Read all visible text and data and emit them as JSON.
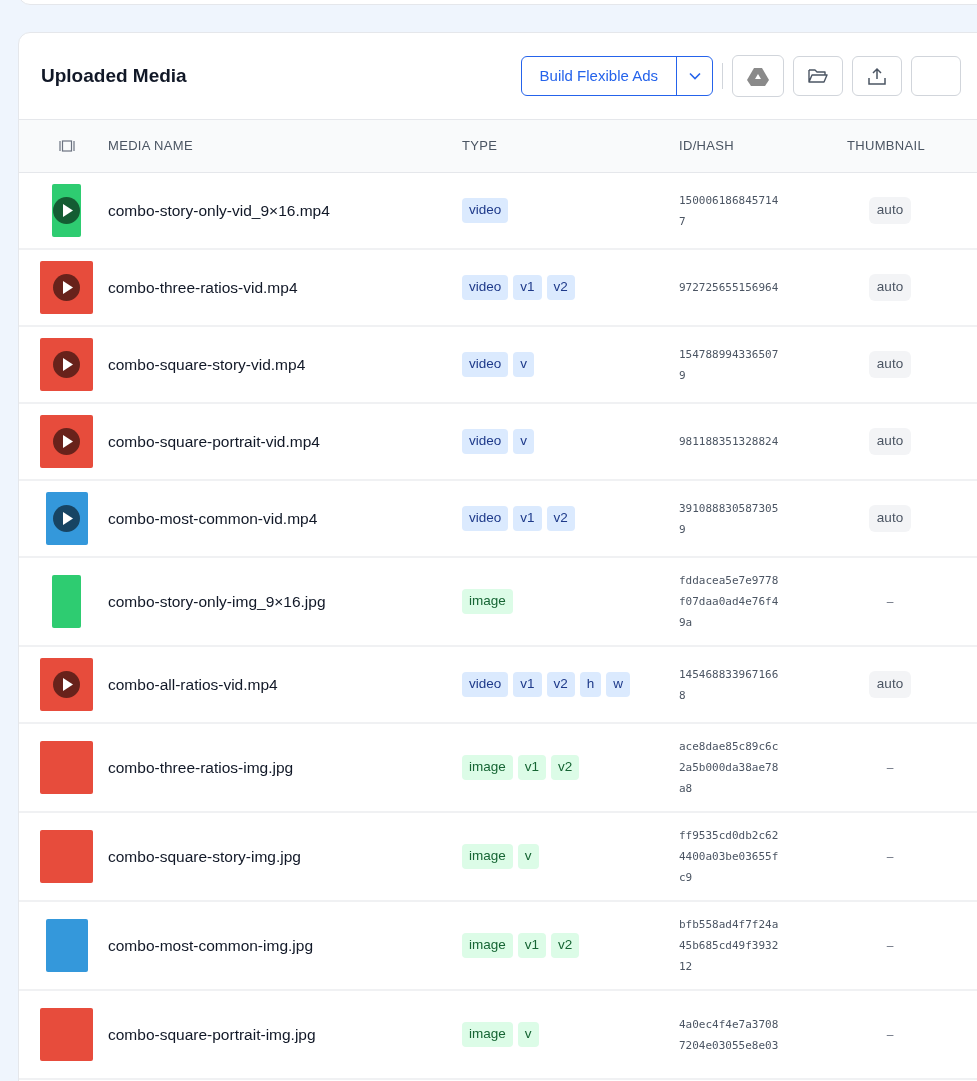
{
  "title": "Uploaded Media",
  "toolbar": {
    "primary_button": "Build Flexible Ads"
  },
  "table": {
    "columns": [
      "MEDIA NAME",
      "TYPE",
      "ID/HASH",
      "THUMBNAIL"
    ],
    "rows": [
      {
        "kind": "video",
        "preview": {
          "kind": "tall",
          "color": "#2ecc71"
        },
        "name": "combo-story-only-vid_9×16.mp4",
        "tags": [
          "video"
        ],
        "id": "1500061868457147",
        "thumbnail": "auto"
      },
      {
        "kind": "video",
        "preview": {
          "kind": "square",
          "color": "#e74c3c"
        },
        "name": "combo-three-ratios-vid.mp4",
        "tags": [
          "video",
          "v1",
          "v2"
        ],
        "id": "972725655156964",
        "thumbnail": "auto"
      },
      {
        "kind": "video",
        "preview": {
          "kind": "square",
          "color": "#e74c3c"
        },
        "name": "combo-square-story-vid.mp4",
        "tags": [
          "video",
          "v"
        ],
        "id": "1547889943365079",
        "thumbnail": "auto"
      },
      {
        "kind": "video",
        "preview": {
          "kind": "square",
          "color": "#e74c3c"
        },
        "name": "combo-square-portrait-vid.mp4",
        "tags": [
          "video",
          "v"
        ],
        "id": "981188351328824",
        "thumbnail": "auto"
      },
      {
        "kind": "video",
        "preview": {
          "kind": "portrait",
          "color": "#3498db"
        },
        "name": "combo-most-common-vid.mp4",
        "tags": [
          "video",
          "v1",
          "v2"
        ],
        "id": "3910888305873059",
        "thumbnail": "auto"
      },
      {
        "kind": "image",
        "preview": {
          "kind": "tall",
          "color": "#2ecc71"
        },
        "name": "combo-story-only-img_9×16.jpg",
        "tags": [
          "image"
        ],
        "id": "fddacea5e7e9778f07daa0ad4e76f49a",
        "thumbnail": "–"
      },
      {
        "kind": "video",
        "preview": {
          "kind": "square",
          "color": "#e74c3c"
        },
        "name": "combo-all-ratios-vid.mp4",
        "tags": [
          "video",
          "v1",
          "v2",
          "h",
          "w"
        ],
        "id": "1454688339671668",
        "thumbnail": "auto"
      },
      {
        "kind": "image",
        "preview": {
          "kind": "square",
          "color": "#e74c3c"
        },
        "name": "combo-three-ratios-img.jpg",
        "tags": [
          "image",
          "v1",
          "v2"
        ],
        "id": "ace8dae85c89c6c2a5b000da38ae78a8",
        "thumbnail": "–"
      },
      {
        "kind": "image",
        "preview": {
          "kind": "square",
          "color": "#e74c3c"
        },
        "name": "combo-square-story-img.jpg",
        "tags": [
          "image",
          "v"
        ],
        "id": "ff9535cd0db2c624400a03be03655fc9",
        "thumbnail": "–"
      },
      {
        "kind": "image",
        "preview": {
          "kind": "portrait",
          "color": "#3498db"
        },
        "name": "combo-most-common-img.jpg",
        "tags": [
          "image",
          "v1",
          "v2"
        ],
        "id": "bfb558ad4f7f24a45b685cd49f393212",
        "thumbnail": "–"
      },
      {
        "kind": "image",
        "preview": {
          "kind": "square",
          "color": "#e74c3c"
        },
        "name": "combo-square-portrait-img.jpg",
        "tags": [
          "image",
          "v"
        ],
        "id": "4a0ec4f4e7a37087204e03055e8e03",
        "thumbnail": "–"
      }
    ]
  }
}
